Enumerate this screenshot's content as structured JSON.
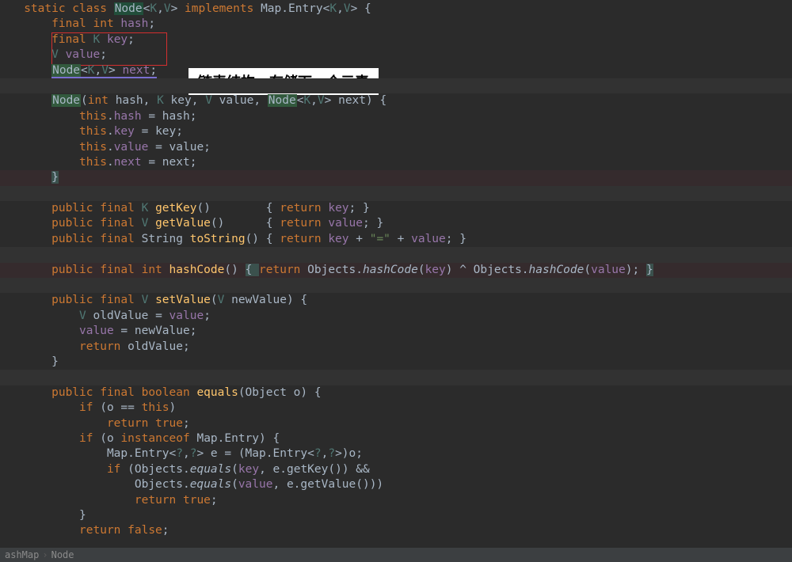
{
  "annotation_text": "链表结构，存储下一个元素",
  "breadcrumb": {
    "root": "ashMap",
    "node": "Node"
  },
  "code": {
    "l1": {
      "a": "   ",
      "b": "static class ",
      "c": "Node",
      "d": "<",
      "e": "K",
      "f": ",",
      "g": "V",
      "h": "> ",
      "i": "implements ",
      "j": "Map.Entry<",
      "k": "K",
      "l": ",",
      "m": "V",
      "n": "> {"
    },
    "l2": {
      "a": "       ",
      "b": "final int ",
      "c": "hash",
      "d": ";"
    },
    "l3": {
      "a": "       ",
      "b": "final ",
      "c": "K ",
      "d": "key",
      "e": ";"
    },
    "l4": {
      "a": "       ",
      "b": "V ",
      "c": "value",
      "d": ";"
    },
    "l5": {
      "a": "       ",
      "b": "Node",
      "c": "<",
      "d": "K",
      "e": ",",
      "f": "V",
      "g": "> ",
      "h": "next",
      "i": ";"
    },
    "l7": {
      "a": "       ",
      "b": "Node",
      "c": "(",
      "d": "int ",
      "e": "hash, ",
      "f": "K ",
      "g": "key, ",
      "h": "V ",
      "i": "value, ",
      "j": "Node",
      "k": "<",
      "l": "K",
      "m": ",",
      "n": "V",
      "o": "> next) {"
    },
    "l8": {
      "a": "           ",
      "b": "this",
      "c": ".",
      "d": "hash ",
      "e": "= hash;"
    },
    "l9": {
      "a": "           ",
      "b": "this",
      "c": ".",
      "d": "key ",
      "e": "= key;"
    },
    "l10": {
      "a": "           ",
      "b": "this",
      "c": ".",
      "d": "value ",
      "e": "= value;"
    },
    "l11": {
      "a": "           ",
      "b": "this",
      "c": ".",
      "d": "next ",
      "e": "= next;"
    },
    "l12": {
      "a": "       ",
      "b": "}"
    },
    "l14": {
      "a": "       ",
      "b": "public final ",
      "c": "K ",
      "d": "getKey",
      "e": "()        { ",
      "f": "return ",
      "g": "key",
      "h": "; }"
    },
    "l15": {
      "a": "       ",
      "b": "public final ",
      "c": "V ",
      "d": "getValue",
      "e": "()      { ",
      "f": "return ",
      "g": "value",
      "h": "; }"
    },
    "l16": {
      "a": "       ",
      "b": "public final ",
      "c": "String ",
      "d": "toString",
      "e": "() { ",
      "f": "return ",
      "g": "key ",
      "h": "+ ",
      "i": "\"=\" ",
      "j": "+ ",
      "k": "value",
      "l": "; }"
    },
    "l18": {
      "a": "       ",
      "b": "public final int ",
      "c": "hashCode",
      "d": "() ",
      "e": "{ ",
      "f": "return ",
      "g": "Objects.",
      "h": "hashCode",
      "i": "(",
      "j": "key",
      "k": ") ^ Objects.",
      "l": "hashCode",
      "m": "(",
      "n": "value",
      "o": "); ",
      "p": "}"
    },
    "l20": {
      "a": "       ",
      "b": "public final ",
      "c": "V ",
      "d": "setValue",
      "e": "(",
      "f": "V ",
      "g": "newValue) {"
    },
    "l21": {
      "a": "           ",
      "b": "V ",
      "c": "oldValue = ",
      "d": "value",
      "e": ";"
    },
    "l22": {
      "a": "           ",
      "b": "value ",
      "c": "= newValue;"
    },
    "l23": {
      "a": "           ",
      "b": "return ",
      "c": "oldValue;"
    },
    "l24": {
      "a": "       }"
    },
    "l26": {
      "a": "       ",
      "b": "public final boolean ",
      "c": "equals",
      "d": "(Object o) {"
    },
    "l27": {
      "a": "           ",
      "b": "if ",
      "c": "(o == ",
      "d": "this",
      "e": ")"
    },
    "l28": {
      "a": "               ",
      "b": "return true",
      "c": ";"
    },
    "l29": {
      "a": "           ",
      "b": "if ",
      "c": "(o ",
      "d": "instanceof ",
      "e": "Map.Entry) {"
    },
    "l30": {
      "a": "               Map.Entry<",
      "b": "?",
      "c": ",",
      "d": "?",
      "e": "> e = (Map.Entry<",
      "f": "?",
      "g": ",",
      "h": "?",
      "i": ">)o;"
    },
    "l31": {
      "a": "               ",
      "b": "if ",
      "c": "(Objects.",
      "d": "equals",
      "e": "(",
      "f": "key",
      "g": ", e.getKey()) &&"
    },
    "l32": {
      "a": "                   Objects.",
      "b": "equals",
      "c": "(",
      "d": "value",
      "e": ", e.getValue()))"
    },
    "l33": {
      "a": "                   ",
      "b": "return true",
      "c": ";"
    },
    "l34": {
      "a": "           }"
    },
    "l35": {
      "a": "           ",
      "b": "return false",
      "c": ";"
    }
  }
}
